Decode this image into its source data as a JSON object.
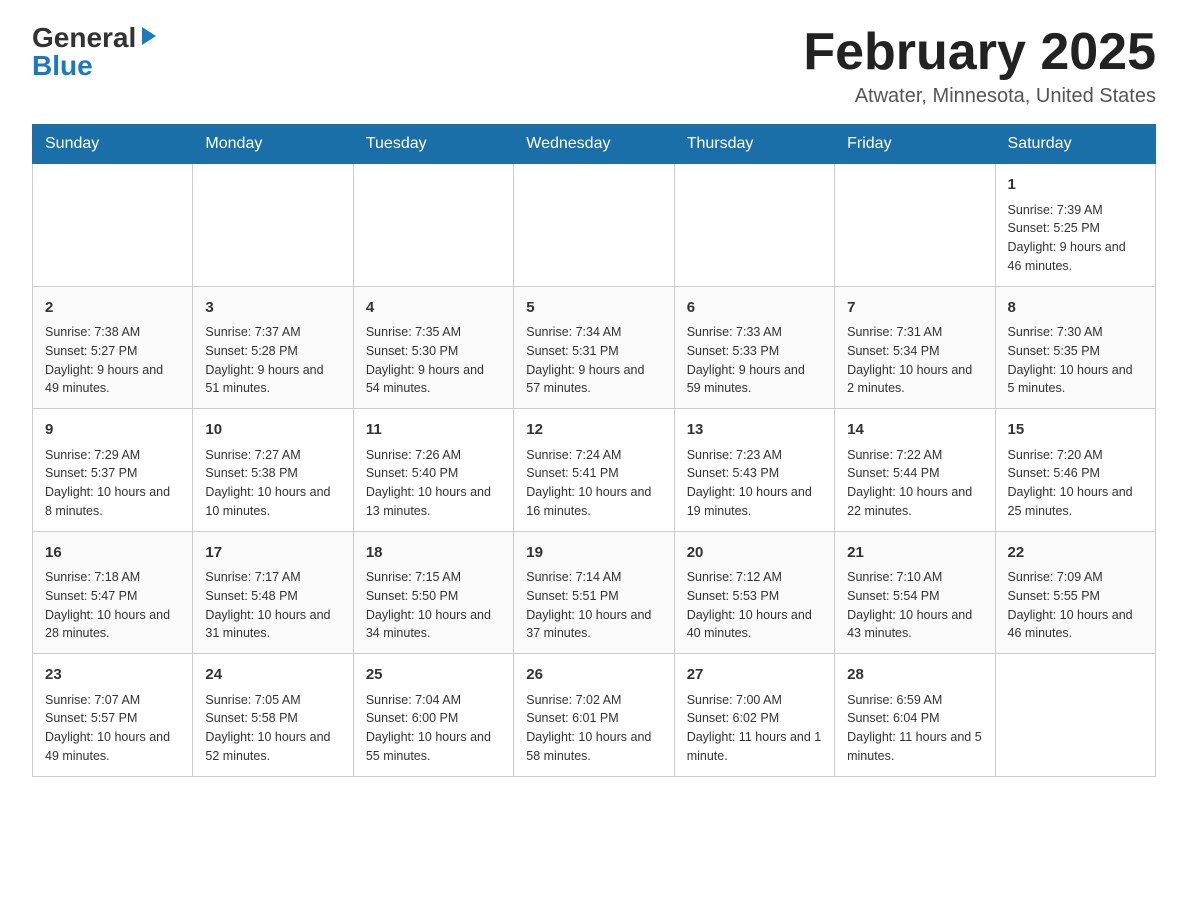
{
  "header": {
    "logo_general": "General",
    "logo_blue": "Blue",
    "month_title": "February 2025",
    "location": "Atwater, Minnesota, United States"
  },
  "weekdays": [
    "Sunday",
    "Monday",
    "Tuesday",
    "Wednesday",
    "Thursday",
    "Friday",
    "Saturday"
  ],
  "weeks": [
    {
      "days": [
        {
          "date": "",
          "info": ""
        },
        {
          "date": "",
          "info": ""
        },
        {
          "date": "",
          "info": ""
        },
        {
          "date": "",
          "info": ""
        },
        {
          "date": "",
          "info": ""
        },
        {
          "date": "",
          "info": ""
        },
        {
          "date": "1",
          "info": "Sunrise: 7:39 AM\nSunset: 5:25 PM\nDaylight: 9 hours and 46 minutes."
        }
      ]
    },
    {
      "days": [
        {
          "date": "2",
          "info": "Sunrise: 7:38 AM\nSunset: 5:27 PM\nDaylight: 9 hours and 49 minutes."
        },
        {
          "date": "3",
          "info": "Sunrise: 7:37 AM\nSunset: 5:28 PM\nDaylight: 9 hours and 51 minutes."
        },
        {
          "date": "4",
          "info": "Sunrise: 7:35 AM\nSunset: 5:30 PM\nDaylight: 9 hours and 54 minutes."
        },
        {
          "date": "5",
          "info": "Sunrise: 7:34 AM\nSunset: 5:31 PM\nDaylight: 9 hours and 57 minutes."
        },
        {
          "date": "6",
          "info": "Sunrise: 7:33 AM\nSunset: 5:33 PM\nDaylight: 9 hours and 59 minutes."
        },
        {
          "date": "7",
          "info": "Sunrise: 7:31 AM\nSunset: 5:34 PM\nDaylight: 10 hours and 2 minutes."
        },
        {
          "date": "8",
          "info": "Sunrise: 7:30 AM\nSunset: 5:35 PM\nDaylight: 10 hours and 5 minutes."
        }
      ]
    },
    {
      "days": [
        {
          "date": "9",
          "info": "Sunrise: 7:29 AM\nSunset: 5:37 PM\nDaylight: 10 hours and 8 minutes."
        },
        {
          "date": "10",
          "info": "Sunrise: 7:27 AM\nSunset: 5:38 PM\nDaylight: 10 hours and 10 minutes."
        },
        {
          "date": "11",
          "info": "Sunrise: 7:26 AM\nSunset: 5:40 PM\nDaylight: 10 hours and 13 minutes."
        },
        {
          "date": "12",
          "info": "Sunrise: 7:24 AM\nSunset: 5:41 PM\nDaylight: 10 hours and 16 minutes."
        },
        {
          "date": "13",
          "info": "Sunrise: 7:23 AM\nSunset: 5:43 PM\nDaylight: 10 hours and 19 minutes."
        },
        {
          "date": "14",
          "info": "Sunrise: 7:22 AM\nSunset: 5:44 PM\nDaylight: 10 hours and 22 minutes."
        },
        {
          "date": "15",
          "info": "Sunrise: 7:20 AM\nSunset: 5:46 PM\nDaylight: 10 hours and 25 minutes."
        }
      ]
    },
    {
      "days": [
        {
          "date": "16",
          "info": "Sunrise: 7:18 AM\nSunset: 5:47 PM\nDaylight: 10 hours and 28 minutes."
        },
        {
          "date": "17",
          "info": "Sunrise: 7:17 AM\nSunset: 5:48 PM\nDaylight: 10 hours and 31 minutes."
        },
        {
          "date": "18",
          "info": "Sunrise: 7:15 AM\nSunset: 5:50 PM\nDaylight: 10 hours and 34 minutes."
        },
        {
          "date": "19",
          "info": "Sunrise: 7:14 AM\nSunset: 5:51 PM\nDaylight: 10 hours and 37 minutes."
        },
        {
          "date": "20",
          "info": "Sunrise: 7:12 AM\nSunset: 5:53 PM\nDaylight: 10 hours and 40 minutes."
        },
        {
          "date": "21",
          "info": "Sunrise: 7:10 AM\nSunset: 5:54 PM\nDaylight: 10 hours and 43 minutes."
        },
        {
          "date": "22",
          "info": "Sunrise: 7:09 AM\nSunset: 5:55 PM\nDaylight: 10 hours and 46 minutes."
        }
      ]
    },
    {
      "days": [
        {
          "date": "23",
          "info": "Sunrise: 7:07 AM\nSunset: 5:57 PM\nDaylight: 10 hours and 49 minutes."
        },
        {
          "date": "24",
          "info": "Sunrise: 7:05 AM\nSunset: 5:58 PM\nDaylight: 10 hours and 52 minutes."
        },
        {
          "date": "25",
          "info": "Sunrise: 7:04 AM\nSunset: 6:00 PM\nDaylight: 10 hours and 55 minutes."
        },
        {
          "date": "26",
          "info": "Sunrise: 7:02 AM\nSunset: 6:01 PM\nDaylight: 10 hours and 58 minutes."
        },
        {
          "date": "27",
          "info": "Sunrise: 7:00 AM\nSunset: 6:02 PM\nDaylight: 11 hours and 1 minute."
        },
        {
          "date": "28",
          "info": "Sunrise: 6:59 AM\nSunset: 6:04 PM\nDaylight: 11 hours and 5 minutes."
        },
        {
          "date": "",
          "info": ""
        }
      ]
    }
  ]
}
